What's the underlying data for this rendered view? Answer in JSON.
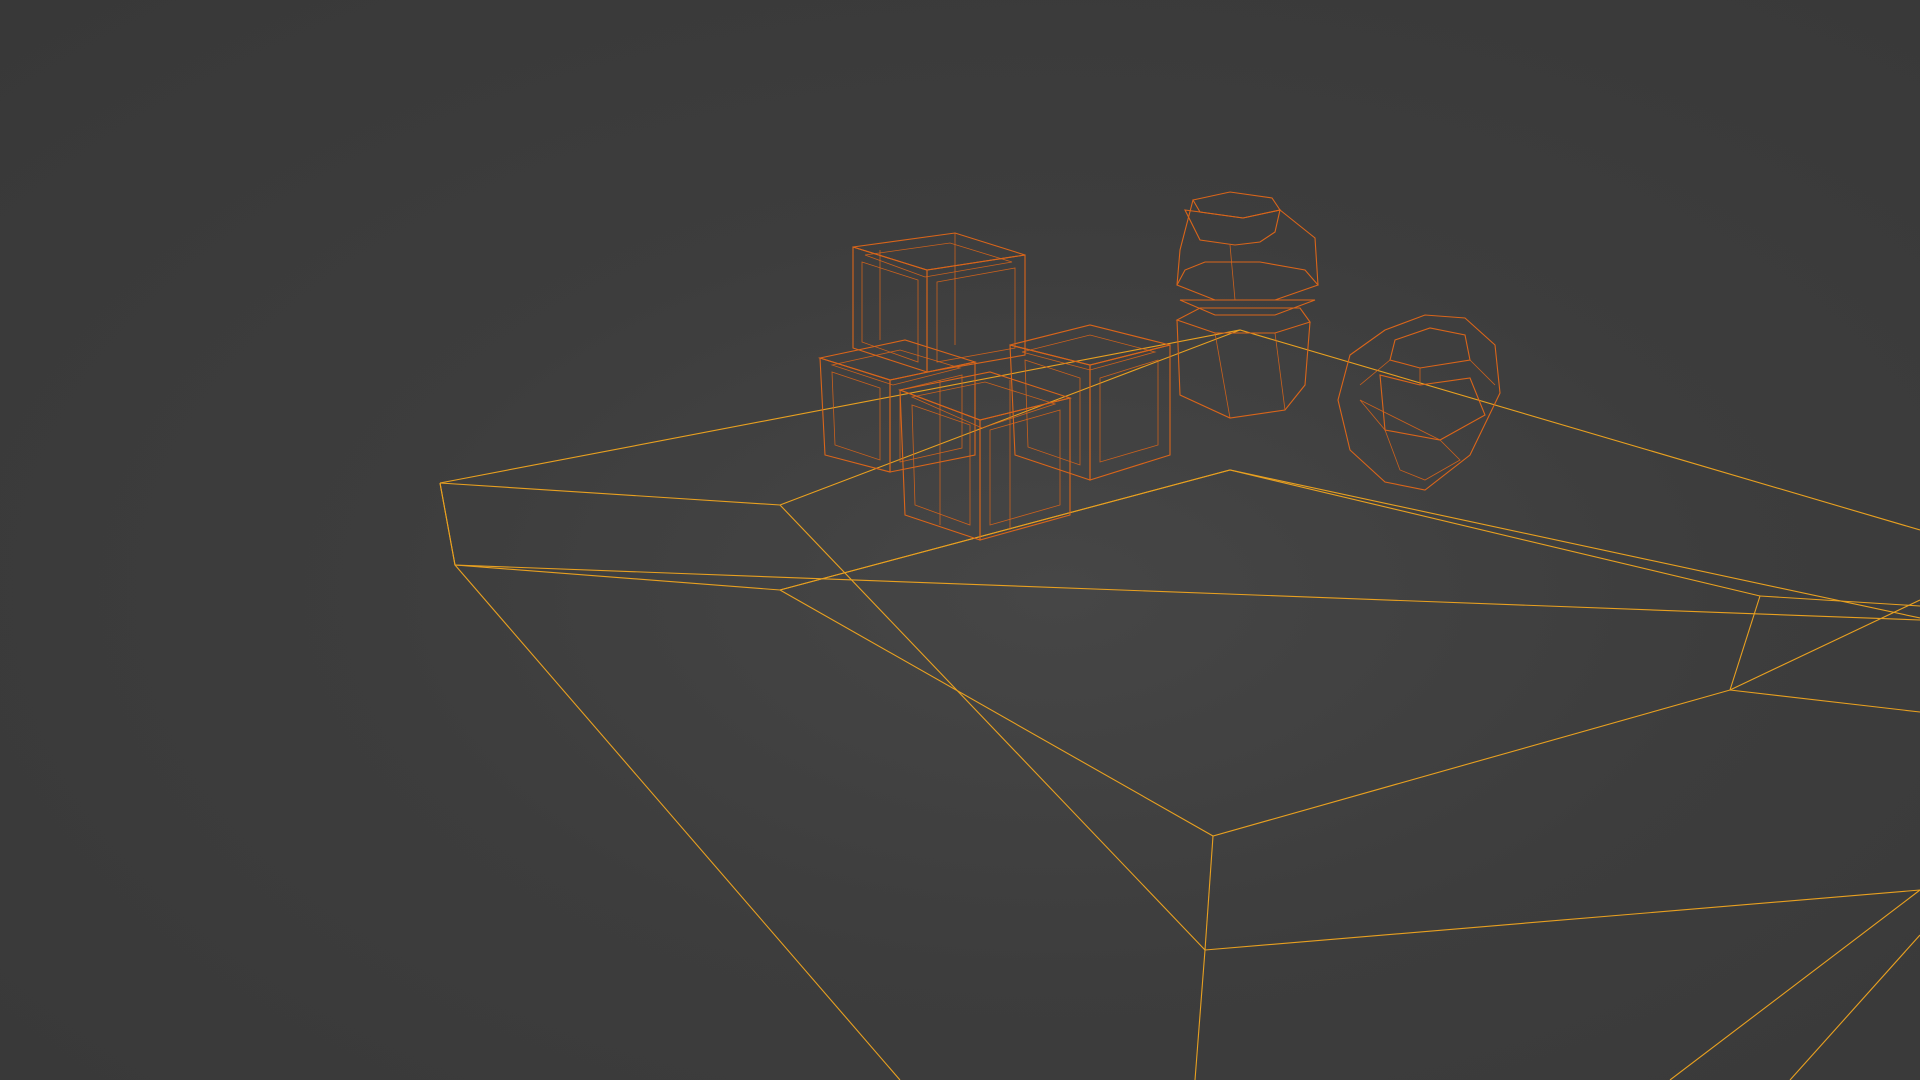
{
  "viewport": {
    "mode": "wireframe",
    "colors": {
      "background": "#3a3a3a",
      "active_object_wire": "#e8a020",
      "selected_object_wire": "#d9651a"
    }
  },
  "scene_objects": [
    {
      "id": "tray",
      "state": "active"
    },
    {
      "id": "cube_upper",
      "state": "selected"
    },
    {
      "id": "cube_lower_left",
      "state": "selected"
    },
    {
      "id": "cube_front",
      "state": "selected"
    },
    {
      "id": "cube_right",
      "state": "selected"
    },
    {
      "id": "cylinder_stack",
      "state": "selected"
    },
    {
      "id": "dodecahedron",
      "state": "selected"
    }
  ]
}
